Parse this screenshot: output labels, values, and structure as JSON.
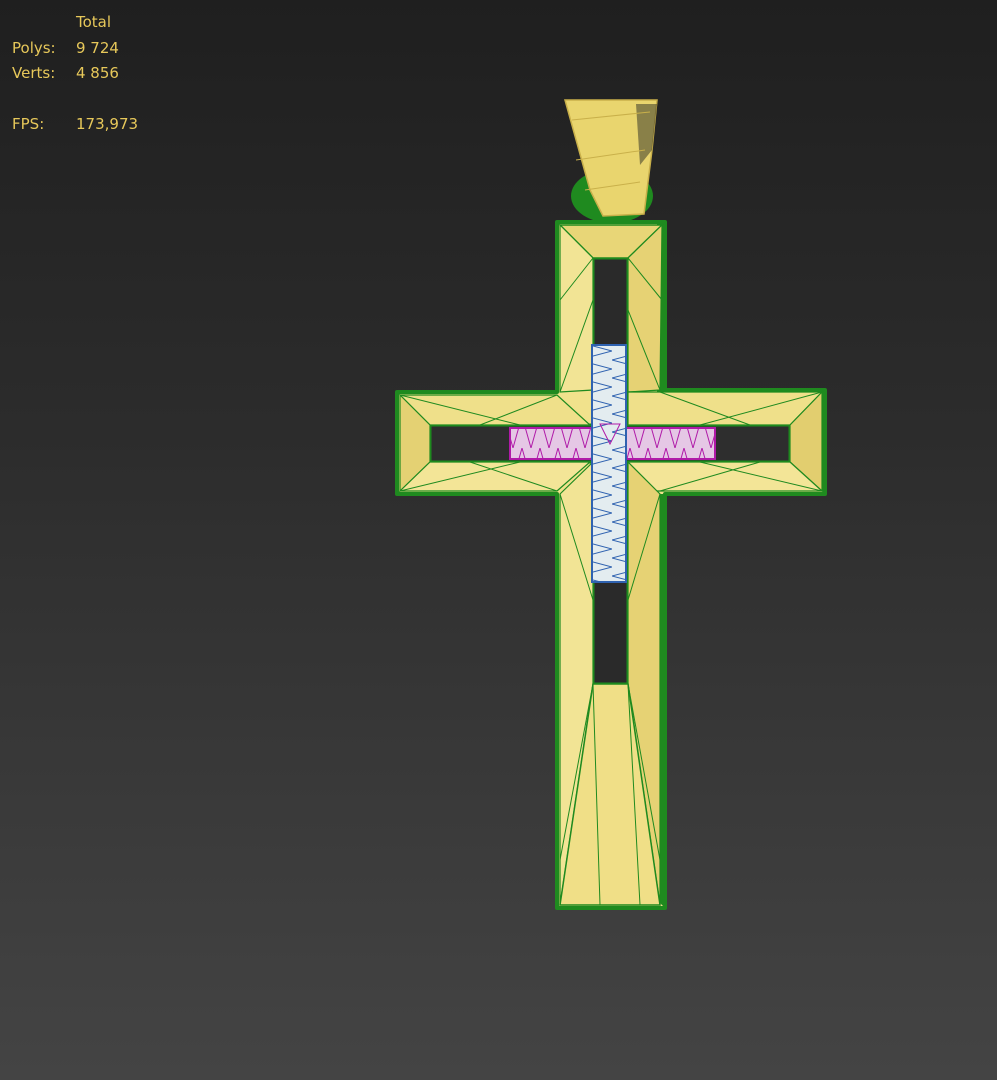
{
  "stats": {
    "header": "Total",
    "polys_label": "Polys:",
    "polys_value": "9 724",
    "verts_label": "Verts:",
    "verts_value": "4 856",
    "fps_label": "FPS:",
    "fps_value": "173,973"
  },
  "colors": {
    "stats_text": "#e7c85a",
    "gold_face": "#f1e28c",
    "gold_shade": "#e3cf6c",
    "edge_green": "#1f8a1f",
    "insert_blue_fill": "#e3ecf0",
    "insert_blue_edge": "#2f62b0",
    "insert_pink_fill": "#e5c7e5",
    "insert_pink_edge": "#b01aa8"
  },
  "model": {
    "object": "cross-pendant",
    "display_mode": "shaded-with-edged-faces"
  }
}
